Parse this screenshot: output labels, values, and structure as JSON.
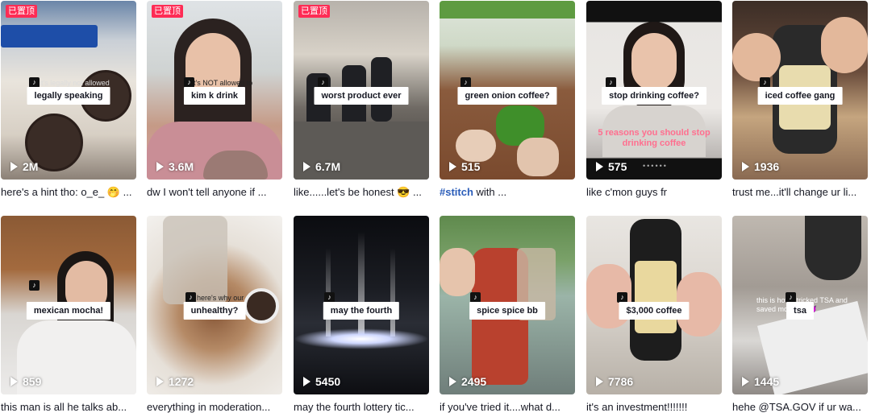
{
  "videos": [
    {
      "pinned_label": "已置顶",
      "sticker": "legally speaking",
      "views": "2M",
      "caption": "here's a hint tho: o_e_ 🤭 ...",
      "bg_text": "it's legally not allowed"
    },
    {
      "pinned_label": "已置顶",
      "sticker": "kim k drink",
      "views": "3.6M",
      "caption": "dw I won't tell anyone if ...",
      "bg_text": "it's NOT allowed to"
    },
    {
      "pinned_label": "已置顶",
      "sticker": "worst product ever",
      "views": "6.7M",
      "caption": "like......let's be honest 😎 ..."
    },
    {
      "sticker": "green onion coffee?",
      "views": "515",
      "caption_hashtag": "#stitch",
      "caption": " with ..."
    },
    {
      "sticker": "stop drinking coffee?",
      "views": "575",
      "caption": "like c'mon guys fr",
      "overlay_text": "5 reasons you should stop drinking coffee"
    },
    {
      "sticker": "iced coffee gang",
      "views": "1936",
      "caption": "trust me...it'll change ur li..."
    },
    {
      "sticker": "mexican mocha!",
      "views": "859",
      "caption": "this man is all he talks ab..."
    },
    {
      "sticker": "unhealthy?",
      "views": "1272",
      "caption": "everything in moderation...",
      "bg_text": "here's why our"
    },
    {
      "sticker": "may the fourth",
      "views": "5450",
      "caption": "may the fourth lottery tic..."
    },
    {
      "sticker": "spice spice bb",
      "views": "2495",
      "caption": "if you've tried it....what d..."
    },
    {
      "sticker": "$3,000 coffee",
      "views": "7786",
      "caption": "it's an investment!!!!!!!"
    },
    {
      "sticker": "tsa",
      "views": "1445",
      "caption": "hehe @TSA.GOV if ur wa...",
      "bg_text": "this is how I tricked TSA and saved money !! 😈"
    }
  ],
  "colors": {
    "pin": "#fe2c55",
    "hashtag": "#2b5db9"
  },
  "icons": {
    "play": "play-icon",
    "tiktok": "tiktok-logo-icon"
  }
}
